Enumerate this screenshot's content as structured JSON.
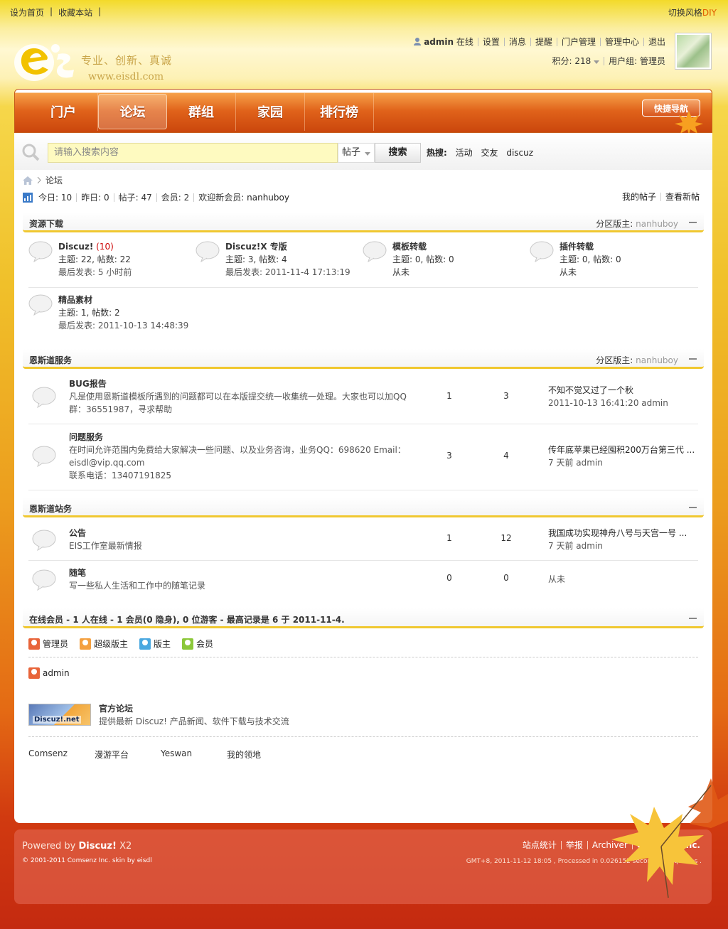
{
  "top": {
    "set_home": "设为首页",
    "bookmark": "收藏本站",
    "sep": "|",
    "switch_style": "切换风格",
    "diy": "DIY"
  },
  "brand": {
    "slogan": "专业、创新、真诚",
    "url": "www.eisdl.com"
  },
  "user": {
    "name": "admin",
    "status": "在线",
    "links": [
      "设置",
      "消息",
      "提醒",
      "门户管理",
      "管理中心",
      "退出"
    ],
    "points": "积分: 218",
    "group": "用户组: 管理员"
  },
  "nav": {
    "items": [
      "门户",
      "论坛",
      "群组",
      "家园",
      "排行榜"
    ],
    "active": 1,
    "quick": "快捷导航"
  },
  "search": {
    "placeholder": "请输入搜索内容",
    "type": "帖子",
    "button": "搜索",
    "hot_label": "热搜:",
    "hot": [
      "活动",
      "交友",
      "discuz"
    ]
  },
  "crumb": {
    "current": "论坛"
  },
  "stats": {
    "today": "今日: 10",
    "yesterday": "昨日: 0",
    "posts": "帖子: 47",
    "members": "会员: 2",
    "welcome": "欢迎新会员: ",
    "newuser": "nanhuboy",
    "my_posts": "我的帖子",
    "new_posts": "查看新帖"
  },
  "cat1": {
    "title": "资源下载",
    "mod_label": "分区版主: ",
    "mod": "nanhuboy",
    "forums": [
      {
        "name": "Discuz!",
        "count": "(10)",
        "stat": "主题: 22, 帖数: 22",
        "last": "最后发表: 5 小时前"
      },
      {
        "name": "Discuz!X 专版",
        "count": "",
        "stat": "主题: 3, 帖数: 4",
        "last": "最后发表: 2011-11-4 17:13:19"
      },
      {
        "name": "模板转载",
        "count": "",
        "stat": "主题: 0, 帖数: 0",
        "last": "从未"
      },
      {
        "name": "插件转载",
        "count": "",
        "stat": "主题: 0, 帖数: 0",
        "last": "从未"
      },
      {
        "name": "精品素材",
        "count": "",
        "stat": "主题: 1, 帖数: 2",
        "last": "最后发表: 2011-10-13 14:48:39"
      }
    ]
  },
  "cat2": {
    "title": "恩斯道服务",
    "mod_label": "分区版主: ",
    "mod": "nanhuboy",
    "forums": [
      {
        "name": "BUG报告",
        "desc1": "凡是使用恩斯道模板所遇到的问题都可以在本版提交统一收集统一处理。大家也可以加QQ",
        "desc2": "群：36551987，寻求帮助",
        "desc3": "",
        "threads": "1",
        "posts": "3",
        "last_title": "不知不觉又过了一个秋",
        "last_time": "2011-10-13 16:41:20 admin"
      },
      {
        "name": "问题服务",
        "desc1": "在时间允许范围内免费给大家解决一些问题、以及业务咨询，业务QQ：698620 Email：",
        "desc2": "eisdl@vip.qq.com",
        "desc3": "联系电话：13407191825",
        "threads": "3",
        "posts": "4",
        "last_title": "传年底苹果已经囤积200万台第三代 ...",
        "last_time": "7 天前 admin"
      }
    ]
  },
  "cat3": {
    "title": "恩斯道站务",
    "forums": [
      {
        "name": "公告",
        "desc1": "EIS工作室最新情报",
        "threads": "1",
        "posts": "12",
        "last_title": "我国成功实现神舟八号与天宫一号 ...",
        "last_time": "7 天前 admin"
      },
      {
        "name": "随笔",
        "desc1": "写一些私人生活和工作中的随笔记录",
        "threads": "0",
        "posts": "0",
        "last_title": "",
        "last_time": "从未"
      }
    ]
  },
  "online": {
    "title": "在线会员 - 1 人在线 - 1 会员(0 隐身), 0 位游客 - 最高记录是 6 于 2011-11-4.",
    "legend": [
      "管理员",
      "超级版主",
      "版主",
      "会员"
    ],
    "legend_colors": [
      "#e8643a",
      "#f4a040",
      "#4aa8e0",
      "#8cc83a"
    ],
    "users": [
      "admin"
    ]
  },
  "partner": {
    "logo_text": "Discuz!.net",
    "title": "官方论坛",
    "desc": "提供最新 Discuz! 产品新闻、软件下载与技术交流"
  },
  "friends": [
    "Comsenz",
    "漫游平台",
    "Yeswan",
    "我的领地"
  ],
  "footer": {
    "powered": "Powered by ",
    "discuz": "Discuz!",
    "ver": " X2",
    "copyright": "© 2001-2011 Comsenz Inc. skin by eisdl",
    "links": [
      "站点统计",
      "举报",
      "Archiver",
      "Comsenz Inc."
    ],
    "gmt": "GMT+8, 2011-11-12 18:05 , Processed in 0.026152 second(s), 8 queries ."
  }
}
